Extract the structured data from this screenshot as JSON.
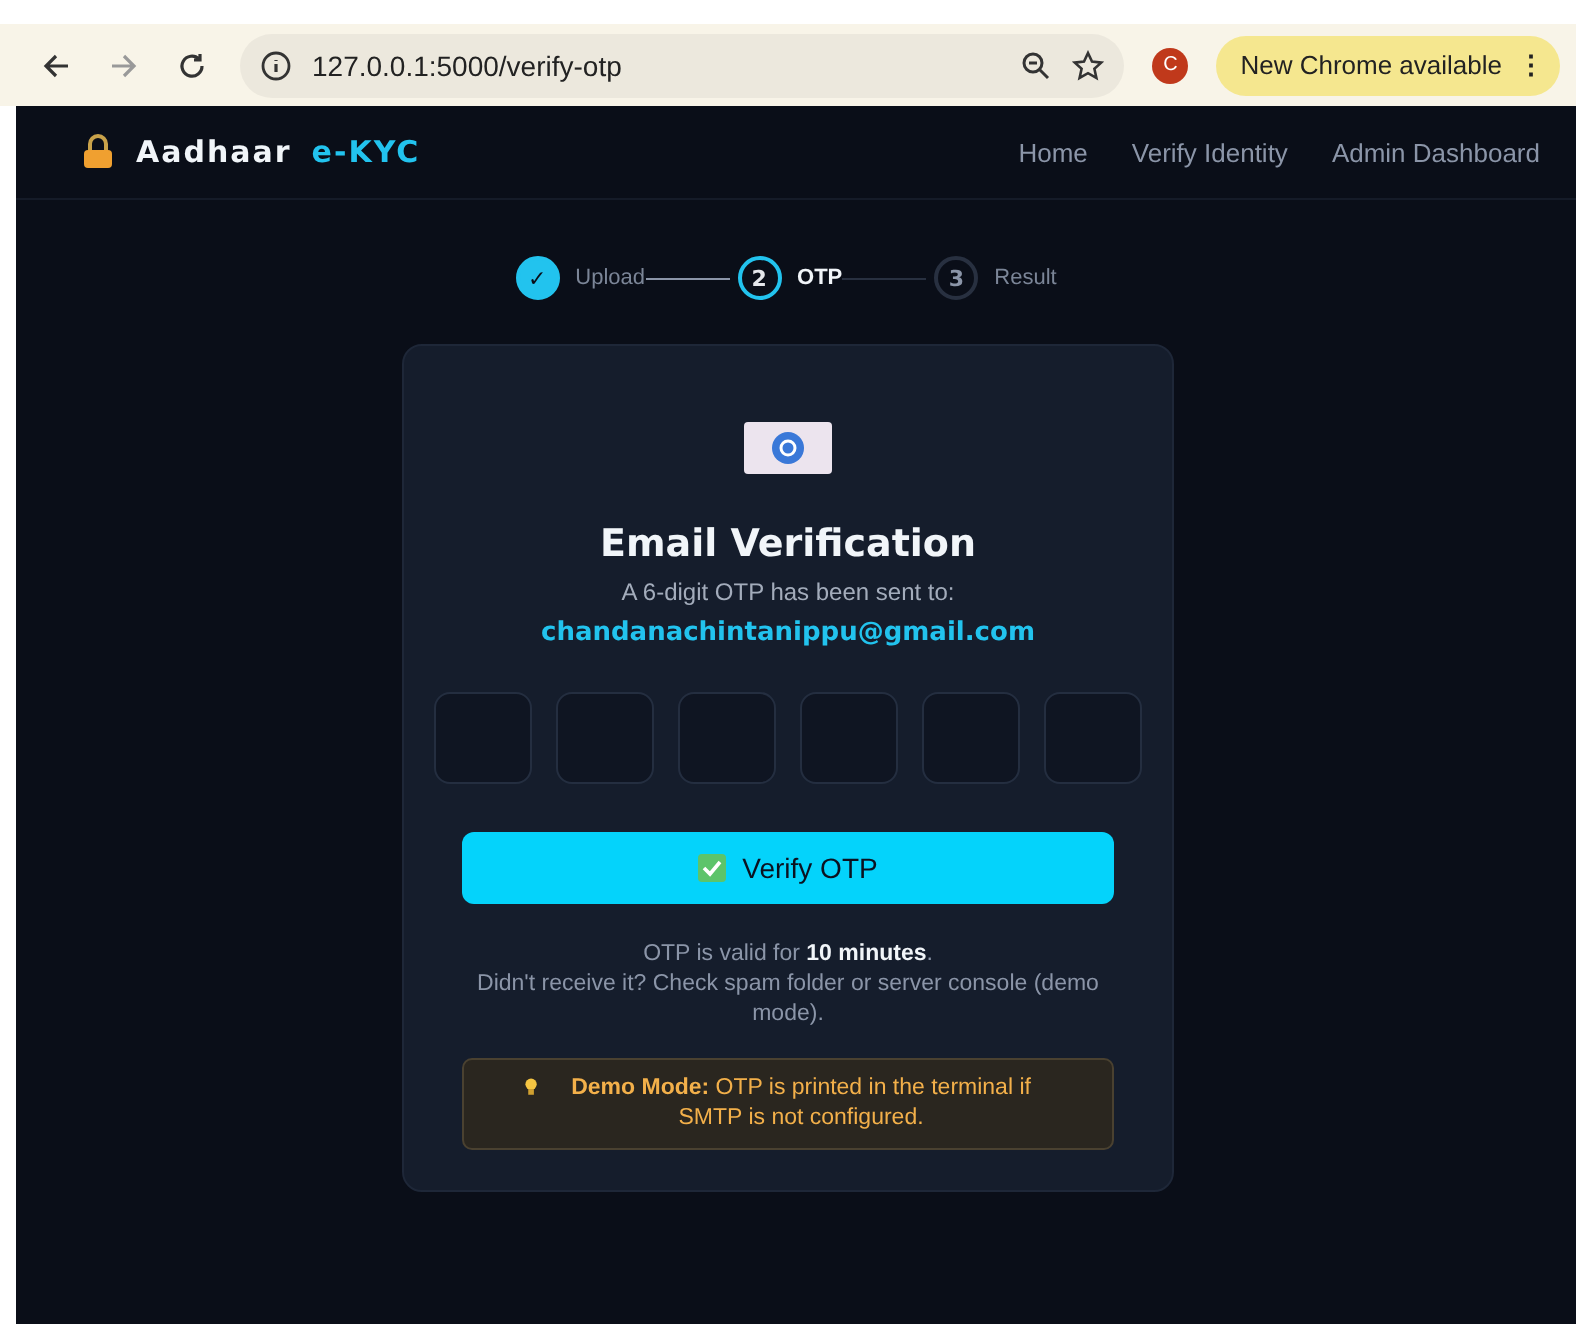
{
  "browser": {
    "url": "127.0.0.1:5000/verify-otp",
    "profile_initial": "C",
    "update_label": "New Chrome available",
    "update_menu": "⋮"
  },
  "nav": {
    "brand": "Aadhaar",
    "brand_accent": "e-KYC",
    "links": [
      "Home",
      "Verify Identity",
      "Admin Dashboard"
    ]
  },
  "steps": [
    {
      "marker": "✓",
      "label": "Upload",
      "kind": "done"
    },
    {
      "marker": "2",
      "label": "OTP",
      "kind": "active"
    },
    {
      "marker": "3",
      "label": "Result",
      "kind": "pending"
    }
  ],
  "card": {
    "title": "Email Verification",
    "subtitle": "A 6-digit OTP has been sent to:",
    "email": "chandanachintanippu@gmail.com",
    "otp_boxes": [
      {
        "filled": false
      },
      {
        "filled": false
      },
      {
        "filled": false
      },
      {
        "filled": false
      },
      {
        "filled": false
      },
      {
        "filled": false
      }
    ],
    "button": "Verify OTP",
    "validity": "OTP is valid for **10 minutes**.",
    "help": "Didn't receive it? Check spam folder or server console (demo mode).",
    "notice": "**Demo Mode:** OTP is printed in the terminal if SMTP is not configured."
  }
}
